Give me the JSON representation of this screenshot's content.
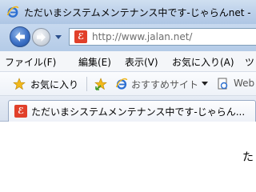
{
  "window": {
    "title": "ただいまシステムメンテナンス中です-じゃらんnet -"
  },
  "nav": {
    "url": "http://www.jalan.net/"
  },
  "menu": {
    "items": [
      "ファイル(F)",
      "編集(E)",
      "表示(V)",
      "お気に入り(A)",
      "ツ"
    ]
  },
  "favorites_bar": {
    "favorites_label": "お気に入り",
    "suggested_sites_label": "おすすめサイト",
    "web_slice_label": "Web"
  },
  "tabs": [
    {
      "label": "ただいまシステムメンテナンス中です-じゃらん..."
    }
  ],
  "page": {
    "partial_text": "た"
  },
  "colors": {
    "site_icon": "#e1402a",
    "ie_blue": "#2c6fd1",
    "star_gold": "#f2b81b"
  }
}
